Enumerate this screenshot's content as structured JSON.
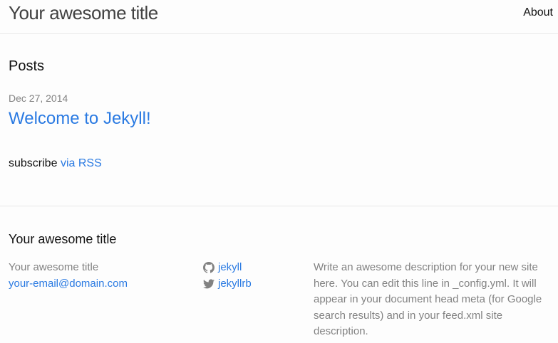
{
  "header": {
    "site_title": "Your awesome title",
    "nav": {
      "about": "About"
    }
  },
  "main": {
    "heading": "Posts",
    "posts": [
      {
        "date": "Dec 27, 2014",
        "title": "Welcome to Jekyll!"
      }
    ],
    "subscribe": {
      "prefix": "subscribe",
      "link": "via RSS"
    }
  },
  "footer": {
    "heading": "Your awesome title",
    "contact": {
      "name": "Your awesome title",
      "email": "your-email@domain.com"
    },
    "social": {
      "github": {
        "icon": "github-icon",
        "username": "jekyll"
      },
      "twitter": {
        "icon": "twitter-icon",
        "username": "jekyllrb"
      }
    },
    "description": "Write an awesome description for your new site here. You can edit this line in _config.yml. It will appear in your document head meta (for Google search results) and in your feed.xml site description."
  },
  "colors": {
    "link": "#2a7ae2",
    "muted": "#828282",
    "text": "#111111",
    "border": "#e8e8e8",
    "background": "#fdfdfd"
  }
}
